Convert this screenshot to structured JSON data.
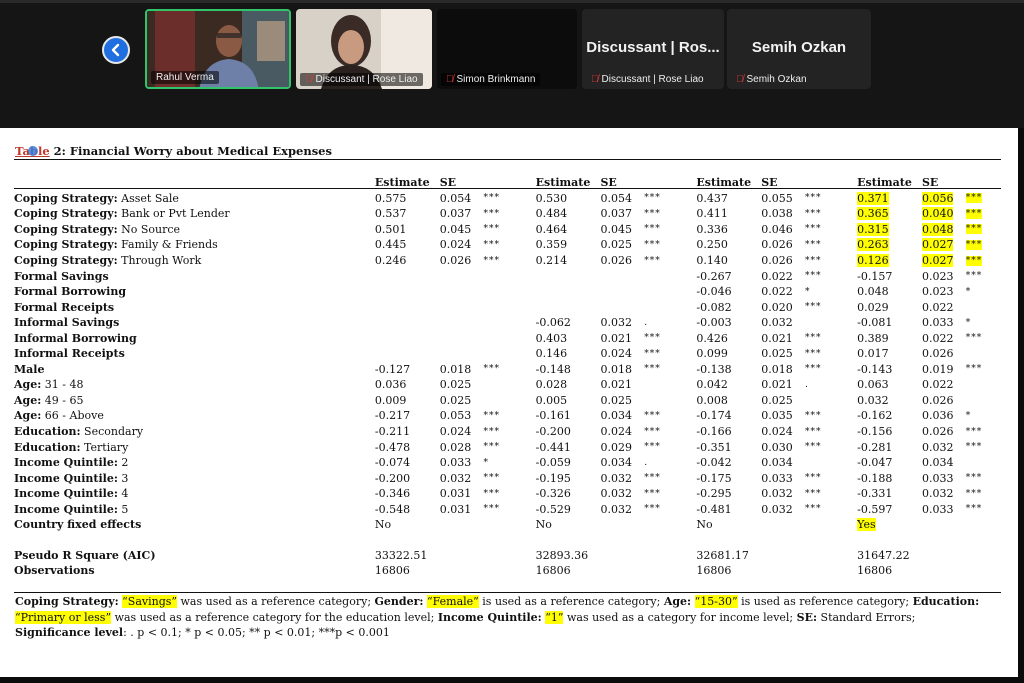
{
  "meeting": {
    "participants": [
      {
        "name": "Rahul Verma",
        "muted": false,
        "active": true
      },
      {
        "name": "Discussant | Rose Liao",
        "muted": true
      },
      {
        "name": "Simon Brinkmann",
        "muted": true
      },
      {
        "name": "Discussant | Rose Liao",
        "muted": true,
        "display": "Discussant | Ros..."
      },
      {
        "name": "Semih Ozkan",
        "muted": true,
        "display": "Semih Ozkan"
      }
    ],
    "colors": {
      "active_border": "#31c46a",
      "back_button": "#1f6fe0",
      "mic_off": "#e53935",
      "highlight": "#ffff00"
    },
    "icons": {
      "back": "chevron-left-icon",
      "mic": "mic-off-icon"
    }
  },
  "document": {
    "table_title_prefix": "Table",
    "table_title_rest": " 2: Financial Worry about Medical Expenses",
    "headers": [
      "Estimate",
      "SE",
      "Estimate",
      "SE",
      "Estimate",
      "SE",
      "Estimate",
      "SE"
    ],
    "rows": [
      {
        "label": "Coping Strategy:",
        "level": " Asset Sale",
        "m": [
          [
            "0.575",
            "0.054",
            "***"
          ],
          [
            "0.530",
            "0.054",
            "***"
          ],
          [
            "0.437",
            "0.055",
            "***"
          ],
          [
            "0.371",
            "0.056",
            "***"
          ]
        ]
      },
      {
        "label": "Coping Strategy:",
        "level": " Bank or Pvt Lender",
        "m": [
          [
            "0.537",
            "0.037",
            "***"
          ],
          [
            "0.484",
            "0.037",
            "***"
          ],
          [
            "0.411",
            "0.038",
            "***"
          ],
          [
            "0.365",
            "0.040",
            "***"
          ]
        ]
      },
      {
        "label": "Coping Strategy:",
        "level": " No Source",
        "m": [
          [
            "0.501",
            "0.045",
            "***"
          ],
          [
            "0.464",
            "0.045",
            "***"
          ],
          [
            "0.336",
            "0.046",
            "***"
          ],
          [
            "0.315",
            "0.048",
            "***"
          ]
        ]
      },
      {
        "label": "Coping Strategy:",
        "level": " Family & Friends",
        "m": [
          [
            "0.445",
            "0.024",
            "***"
          ],
          [
            "0.359",
            "0.025",
            "***"
          ],
          [
            "0.250",
            "0.026",
            "***"
          ],
          [
            "0.263",
            "0.027",
            "***"
          ]
        ]
      },
      {
        "label": "Coping Strategy:",
        "level": " Through Work",
        "m": [
          [
            "0.246",
            "0.026",
            "***"
          ],
          [
            "0.214",
            "0.026",
            "***"
          ],
          [
            "0.140",
            "0.026",
            "***"
          ],
          [
            "0.126",
            "0.027",
            "***"
          ]
        ]
      },
      {
        "label": "Formal Savings",
        "level": "",
        "m": [
          [
            "",
            "",
            ""
          ],
          [
            "",
            "",
            ""
          ],
          [
            "-0.267",
            "0.022",
            "***"
          ],
          [
            "-0.157",
            "0.023",
            "***"
          ]
        ]
      },
      {
        "label": "Formal Borrowing",
        "level": "",
        "m": [
          [
            "",
            "",
            ""
          ],
          [
            "",
            "",
            ""
          ],
          [
            "-0.046",
            "0.022",
            "*"
          ],
          [
            "0.048",
            "0.023",
            "*"
          ]
        ]
      },
      {
        "label": "Formal Receipts",
        "level": "",
        "m": [
          [
            "",
            "",
            ""
          ],
          [
            "",
            "",
            ""
          ],
          [
            "-0.082",
            "0.020",
            "***"
          ],
          [
            "0.029",
            "0.022",
            ""
          ]
        ]
      },
      {
        "label": "Informal Savings",
        "level": "",
        "m": [
          [
            "",
            "",
            ""
          ],
          [
            "-0.062",
            "0.032",
            "."
          ],
          [
            "-0.003",
            "0.032",
            ""
          ],
          [
            "-0.081",
            "0.033",
            "*"
          ]
        ]
      },
      {
        "label": "Informal Borrowing",
        "level": "",
        "m": [
          [
            "",
            "",
            ""
          ],
          [
            "0.403",
            "0.021",
            "***"
          ],
          [
            "0.426",
            "0.021",
            "***"
          ],
          [
            "0.389",
            "0.022",
            "***"
          ]
        ]
      },
      {
        "label": "Informal Receipts",
        "level": "",
        "m": [
          [
            "",
            "",
            ""
          ],
          [
            "0.146",
            "0.024",
            "***"
          ],
          [
            "0.099",
            "0.025",
            "***"
          ],
          [
            "0.017",
            "0.026",
            ""
          ]
        ]
      },
      {
        "label": "Male",
        "level": "",
        "m": [
          [
            "-0.127",
            "0.018",
            "***"
          ],
          [
            "-0.148",
            "0.018",
            "***"
          ],
          [
            "-0.138",
            "0.018",
            "***"
          ],
          [
            "-0.143",
            "0.019",
            "***"
          ]
        ]
      },
      {
        "label": "Age:",
        "level": " 31 - 48",
        "m": [
          [
            "0.036",
            "0.025",
            ""
          ],
          [
            "0.028",
            "0.021",
            ""
          ],
          [
            "0.042",
            "0.021",
            "."
          ],
          [
            "0.063",
            "0.022",
            ""
          ]
        ]
      },
      {
        "label": "Age:",
        "level": " 49 - 65",
        "m": [
          [
            "0.009",
            "0.025",
            ""
          ],
          [
            "0.005",
            "0.025",
            ""
          ],
          [
            "0.008",
            "0.025",
            ""
          ],
          [
            "0.032",
            "0.026",
            ""
          ]
        ]
      },
      {
        "label": "Age:",
        "level": " 66 - Above",
        "m": [
          [
            "-0.217",
            "0.053",
            "***"
          ],
          [
            "-0.161",
            "0.034",
            "***"
          ],
          [
            "-0.174",
            "0.035",
            "***"
          ],
          [
            "-0.162",
            "0.036",
            "*"
          ]
        ]
      },
      {
        "label": "Education:",
        "level": " Secondary",
        "m": [
          [
            "-0.211",
            "0.024",
            "***"
          ],
          [
            "-0.200",
            "0.024",
            "***"
          ],
          [
            "-0.166",
            "0.024",
            "***"
          ],
          [
            "-0.156",
            "0.026",
            "***"
          ]
        ]
      },
      {
        "label": "Education:",
        "level": " Tertiary",
        "m": [
          [
            "-0.478",
            "0.028",
            "***"
          ],
          [
            "-0.441",
            "0.029",
            "***"
          ],
          [
            "-0.351",
            "0.030",
            "***"
          ],
          [
            "-0.281",
            "0.032",
            "***"
          ]
        ]
      },
      {
        "label": "Income Quintile:",
        "level": " 2",
        "m": [
          [
            "-0.074",
            "0.033",
            "*"
          ],
          [
            "-0.059",
            "0.034",
            "."
          ],
          [
            "-0.042",
            "0.034",
            ""
          ],
          [
            "-0.047",
            "0.034",
            ""
          ]
        ]
      },
      {
        "label": "Income Quintile:",
        "level": " 3",
        "m": [
          [
            "-0.200",
            "0.032",
            "***"
          ],
          [
            "-0.195",
            "0.032",
            "***"
          ],
          [
            "-0.175",
            "0.033",
            "***"
          ],
          [
            "-0.188",
            "0.033",
            "***"
          ]
        ]
      },
      {
        "label": "Income Quintile:",
        "level": " 4",
        "m": [
          [
            "-0.346",
            "0.031",
            "***"
          ],
          [
            "-0.326",
            "0.032",
            "***"
          ],
          [
            "-0.295",
            "0.032",
            "***"
          ],
          [
            "-0.331",
            "0.032",
            "***"
          ]
        ]
      },
      {
        "label": "Income Quintile:",
        "level": " 5",
        "m": [
          [
            "-0.548",
            "0.031",
            "***"
          ],
          [
            "-0.529",
            "0.032",
            "***"
          ],
          [
            "-0.481",
            "0.032",
            "***"
          ],
          [
            "-0.597",
            "0.033",
            "***"
          ]
        ]
      },
      {
        "label": "Country fixed effects",
        "level": "",
        "m": [
          [
            "No",
            "",
            ""
          ],
          [
            "No",
            "",
            ""
          ],
          [
            "No",
            "",
            ""
          ],
          [
            "Yes",
            "",
            ""
          ]
        ]
      }
    ],
    "summary": [
      {
        "label": "Pseudo R Square (AIC)",
        "vals": [
          "33322.51",
          "32893.36",
          "32681.17",
          "31647.22"
        ]
      },
      {
        "label": "Observations",
        "vals": [
          "16806",
          "16806",
          "16806",
          "16806"
        ]
      }
    ],
    "note": [
      {
        "t": "Coping Strategy:",
        "b": true
      },
      {
        "t": " "
      },
      {
        "t": "“Savings”",
        "hl": true
      },
      {
        "t": " was used as a reference category; "
      },
      {
        "t": "Gender:",
        "b": true
      },
      {
        "t": " "
      },
      {
        "t": "“Female”",
        "hl": true
      },
      {
        "t": " is used as a reference category; "
      },
      {
        "t": "Age:",
        "b": true
      },
      {
        "t": " "
      },
      {
        "t": "“15-30”",
        "hl": true
      },
      {
        "t": " is used as reference category; "
      },
      {
        "t": "Education:",
        "b": true
      },
      {
        "t": " "
      },
      {
        "t": "“Primary or less”",
        "hl": true
      },
      {
        "t": " was used as a reference category for the education level; "
      },
      {
        "t": "Income Quintile:",
        "b": true
      },
      {
        "t": " "
      },
      {
        "t": "“1”",
        "hl": true
      },
      {
        "t": " was used as a category for income level; "
      },
      {
        "t": "SE:",
        "b": true
      },
      {
        "t": " Standard Errors; "
      },
      {
        "t": "Significance level",
        "b": true
      },
      {
        "t": ": . p < 0.1; * p < 0.05; ** p < 0.01; ***p < 0.001"
      }
    ]
  }
}
